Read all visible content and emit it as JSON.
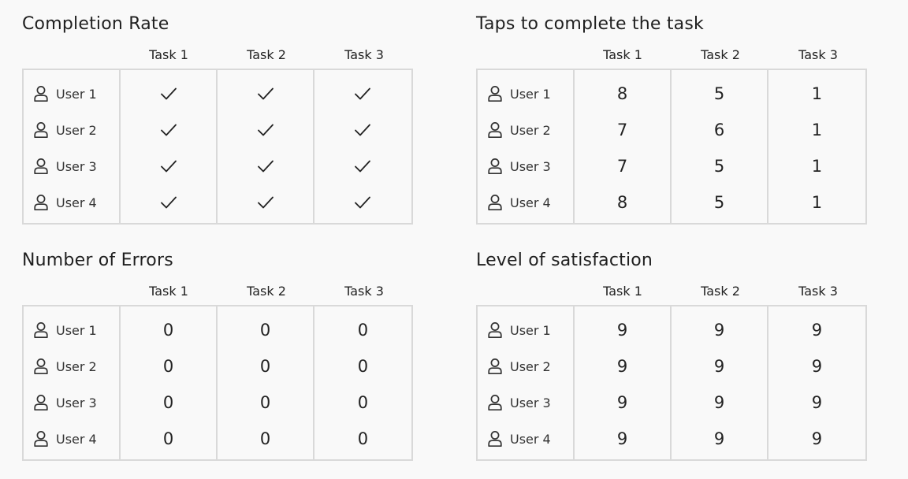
{
  "colors": {
    "background": "#f9f9f9",
    "border": "#d9d9d9",
    "text": "#222222"
  },
  "panels": [
    {
      "id": "completion-rate",
      "title": "Completion Rate",
      "cell_type": "check-icon",
      "headers": [
        "Task 1",
        "Task 2",
        "Task 3"
      ],
      "rows": [
        {
          "user": "User 1",
          "values": [
            "done",
            "done",
            "done"
          ]
        },
        {
          "user": "User 2",
          "values": [
            "done",
            "done",
            "done"
          ]
        },
        {
          "user": "User 3",
          "values": [
            "done",
            "done",
            "done"
          ]
        },
        {
          "user": "User 4",
          "values": [
            "done",
            "done",
            "done"
          ]
        }
      ]
    },
    {
      "id": "taps",
      "title": "Taps to complete the task",
      "cell_type": "text",
      "headers": [
        "Task 1",
        "Task 2",
        "Task 3"
      ],
      "rows": [
        {
          "user": "User 1",
          "values": [
            "8",
            "5",
            "1"
          ]
        },
        {
          "user": "User 2",
          "values": [
            "7",
            "6",
            "1"
          ]
        },
        {
          "user": "User 3",
          "values": [
            "7",
            "5",
            "1"
          ]
        },
        {
          "user": "User 4",
          "values": [
            "8",
            "5",
            "1"
          ]
        }
      ]
    },
    {
      "id": "errors",
      "title": "Number of Errors",
      "cell_type": "text",
      "headers": [
        "Task 1",
        "Task 2",
        "Task 3"
      ],
      "rows": [
        {
          "user": "User 1",
          "values": [
            "0",
            "0",
            "0"
          ]
        },
        {
          "user": "User 2",
          "values": [
            "0",
            "0",
            "0"
          ]
        },
        {
          "user": "User 3",
          "values": [
            "0",
            "0",
            "0"
          ]
        },
        {
          "user": "User 4",
          "values": [
            "0",
            "0",
            "0"
          ]
        }
      ]
    },
    {
      "id": "satisfaction",
      "title": "Level of satisfaction",
      "cell_type": "text",
      "headers": [
        "Task 1",
        "Task 2",
        "Task 3"
      ],
      "rows": [
        {
          "user": "User 1",
          "values": [
            "9",
            "9",
            "9"
          ]
        },
        {
          "user": "User 2",
          "values": [
            "9",
            "9",
            "9"
          ]
        },
        {
          "user": "User 3",
          "values": [
            "9",
            "9",
            "9"
          ]
        },
        {
          "user": "User 4",
          "values": [
            "9",
            "9",
            "9"
          ]
        }
      ]
    }
  ]
}
